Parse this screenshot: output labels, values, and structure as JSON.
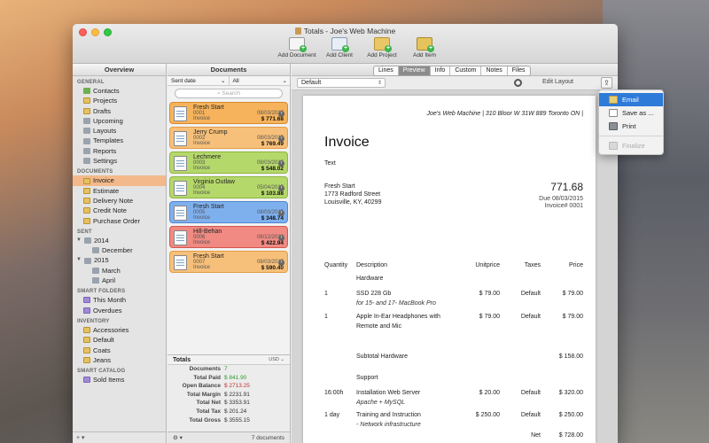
{
  "window": {
    "title": "Totals - Joe's Web Machine"
  },
  "toolbar": [
    {
      "label": "Add Document",
      "icon": "add-document-icon"
    },
    {
      "label": "Add Client",
      "icon": "add-client-icon"
    },
    {
      "label": "Add Project",
      "icon": "add-project-icon"
    },
    {
      "label": "Add Item",
      "icon": "add-item-icon"
    }
  ],
  "sidebar": {
    "header": "Overview",
    "sections": {
      "general": "GENERAL",
      "documents": "DOCUMENTS",
      "sent": "SENT",
      "smart_folders": "SMART FOLDERS",
      "inventory": "INVENTORY",
      "smart_catalog": "SMART CATALOG"
    },
    "general": [
      "Contacts",
      "Projects",
      "Drafts",
      "Upcoming",
      "Layouts",
      "Templates",
      "Reports",
      "Settings"
    ],
    "documents": [
      "Invoice",
      "Estimate",
      "Delivery Note",
      "Credit Note",
      "Purchase Order"
    ],
    "sent": {
      "y2014": "2014",
      "december": "December",
      "y2015": "2015",
      "march": "March",
      "april": "April"
    },
    "smart_folders": [
      "This Month",
      "Overdues"
    ],
    "inventory": [
      "Accessories",
      "Default",
      "Coats",
      "Jeans"
    ],
    "smart_catalog": [
      "Sold Items"
    ],
    "footer_add": "+ ▾"
  },
  "documents_panel": {
    "header": "Documents",
    "filter_sort": "Sent date",
    "filter_scope": "All",
    "search_placeholder": "Search",
    "cards": [
      {
        "name": "Fresh Start",
        "number": "0001",
        "date": "08/03/2015",
        "type": "Invoice",
        "amount": "$ 771.68"
      },
      {
        "name": "Jerry Crump",
        "number": "0002",
        "date": "08/03/2015",
        "type": "Invoice",
        "amount": "$ 769.49"
      },
      {
        "name": "Lechmere",
        "number": "0003",
        "date": "08/03/2015",
        "type": "Invoice",
        "amount": "$ 548.02"
      },
      {
        "name": "Virginia Outlaw",
        "number": "0004",
        "date": "05/04/2015",
        "type": "Invoice",
        "amount": "$ 103.88"
      },
      {
        "name": "Fresh Start",
        "number": "0005",
        "date": "08/03/2015",
        "type": "Invoice",
        "amount": "$ 348.74"
      },
      {
        "name": "Hill-Behan",
        "number": "0006",
        "date": "08/12/2014",
        "type": "Invoice",
        "amount": "$ 422.94"
      },
      {
        "name": "Fresh Start",
        "number": "0007",
        "date": "08/03/2015",
        "type": "Invoice",
        "amount": "$ 590.40"
      }
    ],
    "totals": {
      "header": "Totals",
      "currency": "USD",
      "rows": [
        {
          "label": "Documents",
          "value": "7"
        },
        {
          "label": "Total Paid",
          "value": "$ 841.90"
        },
        {
          "label": "Open Balance",
          "value": "$ 2713.25"
        },
        {
          "label": "Total Margin",
          "value": "$ 2231.91"
        },
        {
          "label": "Total Net",
          "value": "$ 3353.91"
        },
        {
          "label": "Total Tax",
          "value": "$ 201.24"
        },
        {
          "label": "Total Gross",
          "value": "$ 3555.15"
        }
      ]
    },
    "footer_count": "7 documents",
    "footer_actions": "⚙ ▾"
  },
  "main": {
    "tabs": [
      "Lines",
      "Preview",
      "Info",
      "Custom",
      "Notes",
      "Files"
    ],
    "active_tab": "Preview",
    "layout_select": "Default",
    "edit_layout": "Edit Layout",
    "share_menu": [
      {
        "label": "Email",
        "icon": "email-icon"
      },
      {
        "label": "Save as ...",
        "icon": "save-icon"
      },
      {
        "label": "Print",
        "icon": "print-icon"
      },
      {
        "label": "Finalize",
        "icon": "finalize-icon"
      }
    ]
  },
  "invoice": {
    "company_line": "Joe's Web Machine | 310 Bloor W 31W 889 Toronto ON |",
    "title": "Invoice",
    "text": "Text",
    "client_name": "Fresh Start",
    "client_street": "1773 Radford Street",
    "client_city": "Louisville, KY, 40299",
    "total": "771.68",
    "due": "Due 08/03/2015",
    "number": "Invoice# 0001",
    "columns": {
      "qty": "Quantity",
      "desc": "Description",
      "unit": "Unitprice",
      "taxes": "Taxes",
      "price": "Price"
    },
    "hardware_heading": "Hardware",
    "lines_hw": [
      {
        "qty": "1",
        "desc": "SSD 228 Gb",
        "sub": "for 15- and 17- MacBook Pro",
        "unit": "$ 79.00",
        "tax": "Default",
        "price": "$ 79.00"
      },
      {
        "qty": "1",
        "desc": "Apple In-Ear Headphones with",
        "sub2": "Remote and Mic",
        "unit": "$ 79.00",
        "tax": "Default",
        "price": "$ 79.00"
      }
    ],
    "subtotal_hw_label": "Subtotal Hardware",
    "subtotal_hw": "$ 158.00",
    "support_heading": "Support",
    "lines_sp": [
      {
        "qty": "16:00h",
        "desc": "Installation Web Server",
        "sub": "Apache + MySQL",
        "unit": "$ 20.00",
        "tax": "Default",
        "price": "$ 320.00"
      },
      {
        "qty": "1 day",
        "desc": "Training and Instruction",
        "sub": "- Network infrastructure",
        "unit": "$ 250.00",
        "tax": "Default",
        "price": "$ 250.00"
      }
    ],
    "net_label": "Net",
    "net_value": "$ 728.00"
  }
}
